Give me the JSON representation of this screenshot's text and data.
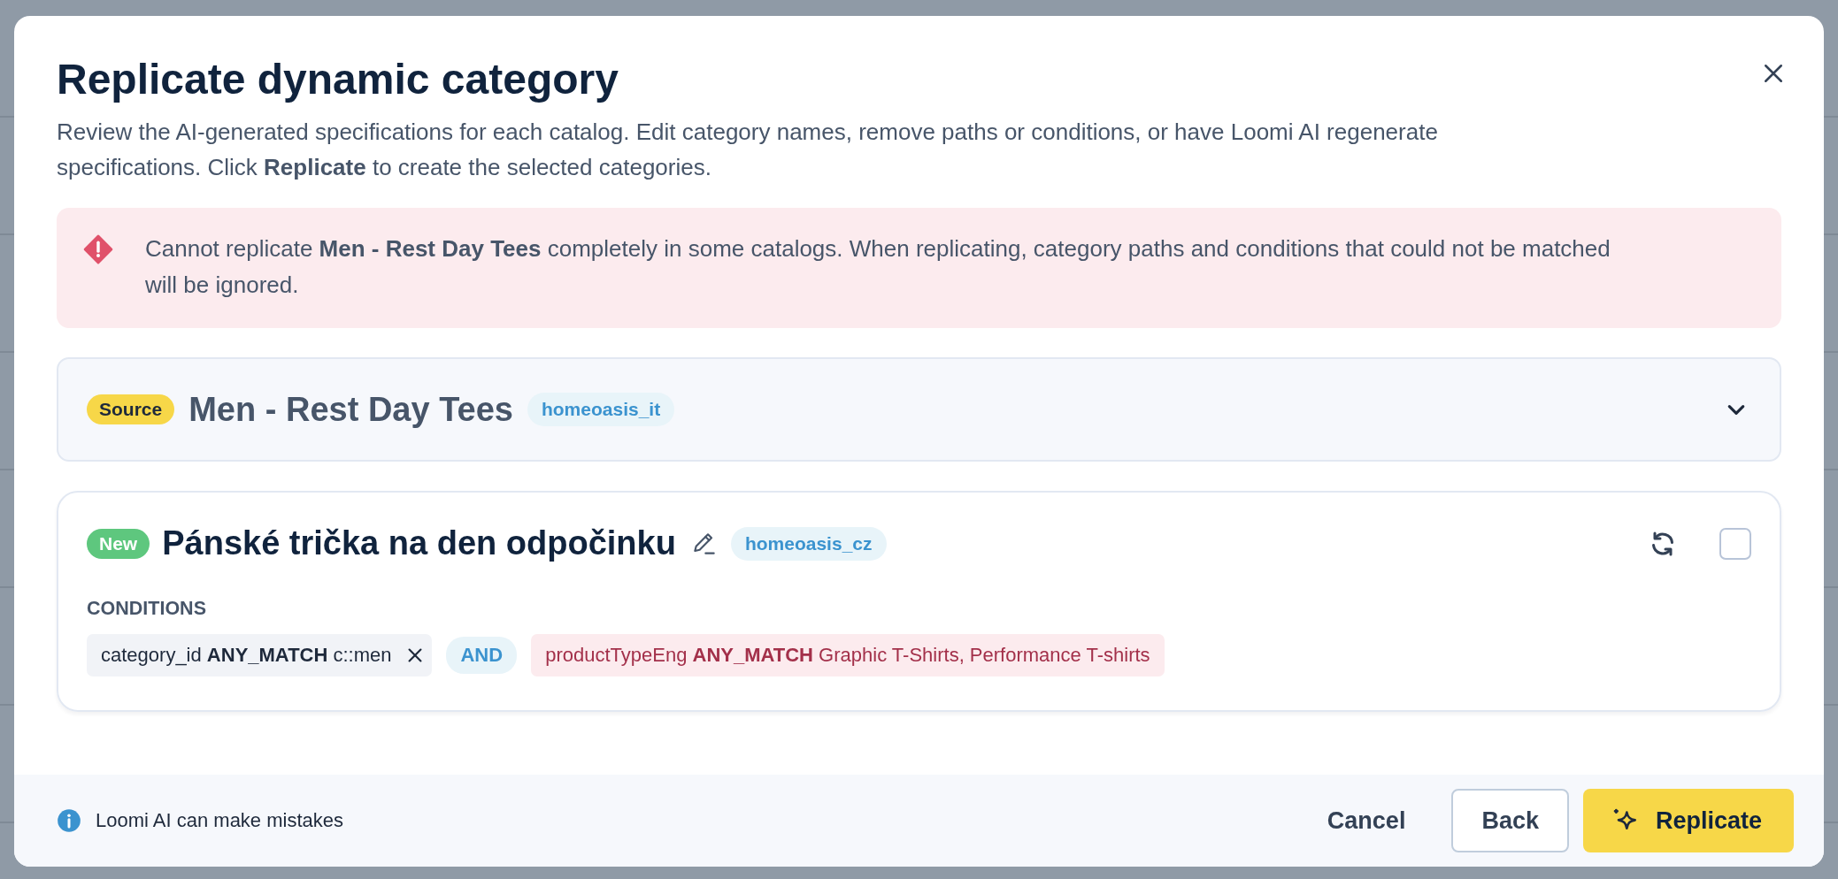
{
  "dialog": {
    "title": "Replicate dynamic category",
    "description": "Review the AI-generated specifications for each catalog. Edit category names, remove paths or conditions, or have Loomi AI regenerate specifications. Click **Replicate** to create the selected categories."
  },
  "alert": {
    "kind": "error",
    "message": "Cannot replicate **Men - Rest Day Tees** completely in some catalogs. When replicating, category paths and conditions that could not be matched will be ignored."
  },
  "source": {
    "badge": "Source",
    "name": "Men - Rest Day Tees",
    "catalog": "homeoasis_it",
    "expanded": false
  },
  "new_categories": [
    {
      "badge": "New",
      "name": "Pánské trička na den odpočinku",
      "catalog": "homeoasis_cz",
      "selected": false,
      "conditions_label": "CONDITIONS",
      "conditions": [
        {
          "kind": "matched",
          "text": "category_id **ANY_MATCH** c::men",
          "removable": true
        },
        {
          "kind": "operator",
          "text": "AND"
        },
        {
          "kind": "unmatched",
          "text": "productTypeEng **ANY_MATCH** Graphic T-Shirts, Performance T-shirts"
        }
      ]
    }
  ],
  "footer": {
    "note": "Loomi AI can make mistakes",
    "buttons": [
      {
        "label": "Cancel",
        "kind": "text"
      },
      {
        "label": "Back",
        "kind": "outline"
      },
      {
        "label": "Replicate",
        "kind": "primary"
      }
    ]
  }
}
